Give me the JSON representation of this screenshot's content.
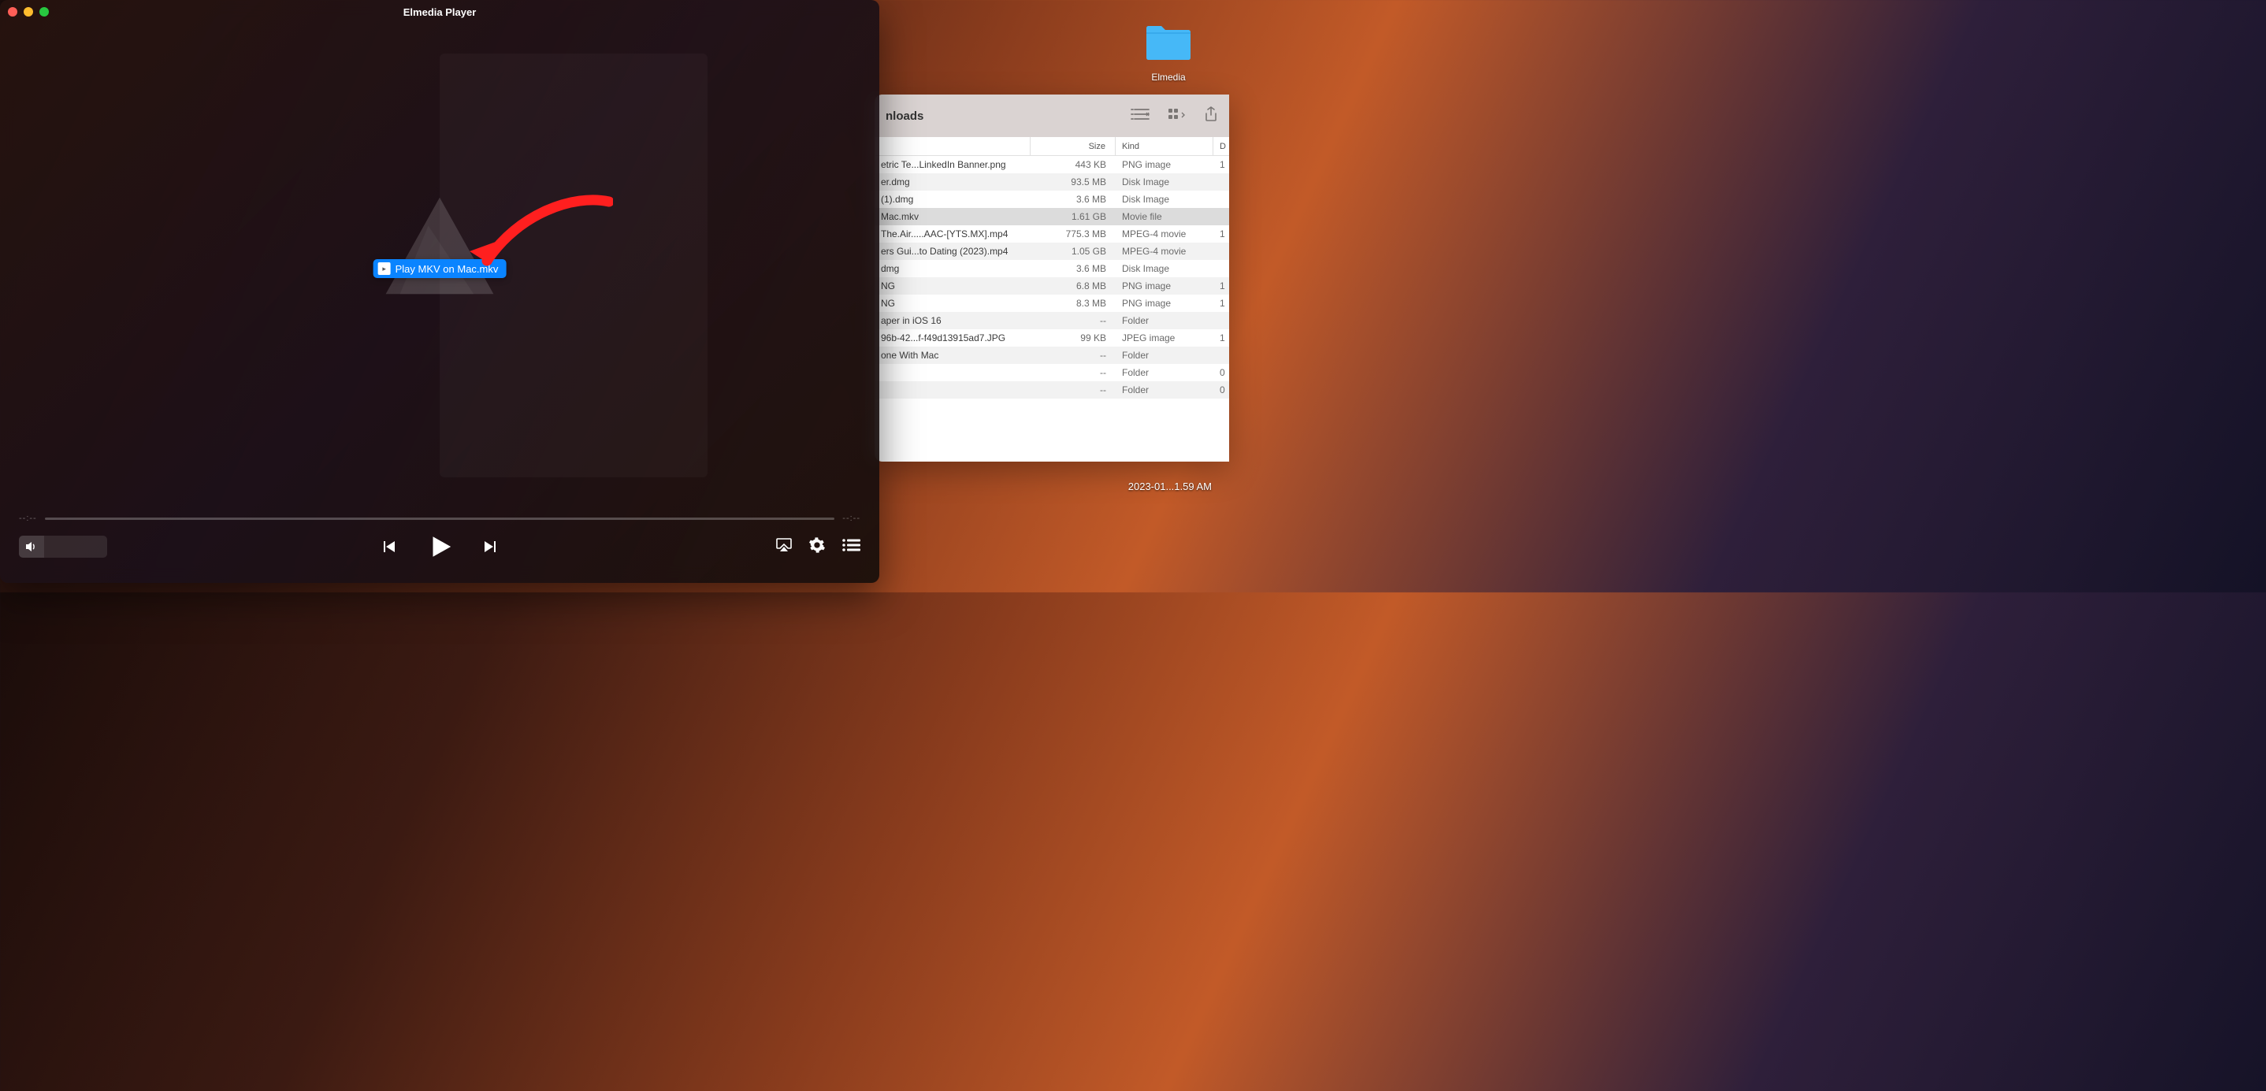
{
  "desktop": {
    "folder_label": "Elmedia"
  },
  "player": {
    "title": "Elmedia Player",
    "drag_file_name": "Play MKV on Mac.mkv",
    "time_start": "--:--",
    "time_end": "--:--"
  },
  "finder": {
    "window_title_visible": "nloads",
    "columns": {
      "size": "Size",
      "kind": "Kind",
      "date_initial": "D"
    },
    "rows": [
      {
        "name": "etric Te...LinkedIn Banner.png",
        "size": "443 KB",
        "kind": "PNG image",
        "date": "1",
        "selected": false
      },
      {
        "name": "er.dmg",
        "size": "93.5 MB",
        "kind": "Disk Image",
        "date": "",
        "selected": false
      },
      {
        "name": "(1).dmg",
        "size": "3.6 MB",
        "kind": "Disk Image",
        "date": "",
        "selected": false
      },
      {
        "name": " Mac.mkv",
        "size": "1.61 GB",
        "kind": "Movie file",
        "date": "",
        "selected": true
      },
      {
        "name": "The.Air.....AAC-[YTS.MX].mp4",
        "size": "775.3 MB",
        "kind": "MPEG-4 movie",
        "date": "1",
        "selected": false
      },
      {
        "name": "ers Gui...to Dating (2023).mp4",
        "size": "1.05 GB",
        "kind": "MPEG-4 movie",
        "date": "",
        "selected": false
      },
      {
        "name": "dmg",
        "size": "3.6 MB",
        "kind": "Disk Image",
        "date": "",
        "selected": false
      },
      {
        "name": "NG",
        "size": "6.8 MB",
        "kind": "PNG image",
        "date": "1",
        "selected": false
      },
      {
        "name": "NG",
        "size": "8.3 MB",
        "kind": "PNG image",
        "date": "1",
        "selected": false
      },
      {
        "name": "aper in iOS 16",
        "size": "--",
        "kind": "Folder",
        "date": "",
        "selected": false
      },
      {
        "name": "96b-42...f-f49d13915ad7.JPG",
        "size": "99 KB",
        "kind": "JPEG image",
        "date": "1",
        "selected": false
      },
      {
        "name": "one With Mac",
        "size": "--",
        "kind": "Folder",
        "date": "",
        "selected": false
      },
      {
        "name": "",
        "size": "--",
        "kind": "Folder",
        "date": "0",
        "selected": false
      },
      {
        "name": "",
        "size": "--",
        "kind": "Folder",
        "date": "0",
        "selected": false
      }
    ]
  },
  "overlay": {
    "timestamp": "2023-01...1.59 AM"
  }
}
